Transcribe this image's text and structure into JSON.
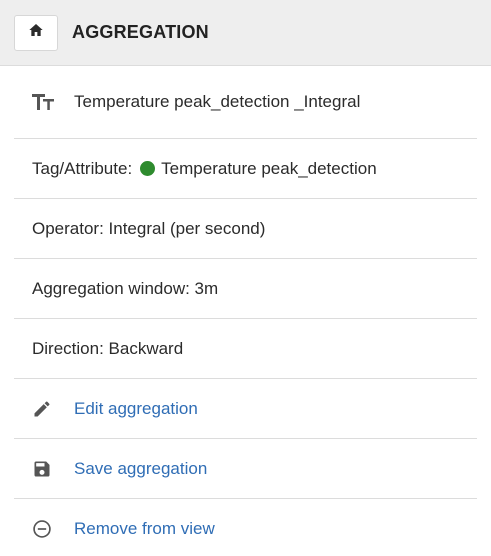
{
  "header": {
    "title": "AGGREGATION",
    "home_icon": "home-icon"
  },
  "aggregation": {
    "name_icon": "text-size-icon",
    "name": "Temperature peak_detection _Integral",
    "tag_label": "Tag/Attribute:",
    "tag_value": "Temperature peak_detection",
    "tag_status_color": "#2e8b2e",
    "operator": "Operator: Integral (per second)",
    "window": "Aggregation window: 3m",
    "direction": "Direction: Backward"
  },
  "actions": {
    "edit": {
      "label": "Edit aggregation",
      "icon": "pencil-icon"
    },
    "save": {
      "label": "Save aggregation",
      "icon": "floppy-disk-icon"
    },
    "remove": {
      "label": "Remove from view",
      "icon": "minus-circle-icon"
    }
  },
  "colors": {
    "link": "#2f6db5",
    "header_bg": "#eeeeee",
    "divider": "#dcdcdc"
  }
}
